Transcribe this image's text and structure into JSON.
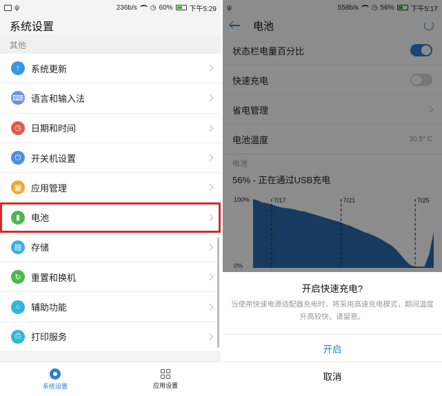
{
  "left": {
    "statusbar": {
      "net_speed": "236b/s",
      "battery_pct": "60%",
      "battery_level": 0.6,
      "time": "下午5:29"
    },
    "title": "系统设置",
    "section_label": "其他",
    "items": [
      {
        "label": "系统更新",
        "icon": "system-update-icon",
        "color": "#3a97e0",
        "glyph": "↑"
      },
      {
        "label": "语言和输入法",
        "icon": "keyboard-icon",
        "color": "#6b8fe0",
        "glyph": "⌨"
      },
      {
        "label": "日期和时间",
        "icon": "clock-icon",
        "color": "#e05a4a",
        "glyph": "◷"
      },
      {
        "label": "开关机设置",
        "icon": "power-icon",
        "color": "#4a8fe0",
        "glyph": "⏻"
      },
      {
        "label": "应用管理",
        "icon": "apps-icon",
        "color": "#f0a830",
        "glyph": "▦"
      },
      {
        "label": "电池",
        "icon": "battery-icon",
        "color": "#4cb84c",
        "glyph": "▮"
      },
      {
        "label": "存储",
        "icon": "storage-icon",
        "color": "#3ab0e0",
        "glyph": "▤"
      },
      {
        "label": "重置和换机",
        "icon": "reset-icon",
        "color": "#4cb84c",
        "glyph": "↻"
      },
      {
        "label": "辅助功能",
        "icon": "accessibility-icon",
        "color": "#2fb6d8",
        "glyph": "○"
      },
      {
        "label": "打印服务",
        "icon": "print-icon",
        "color": "#2fb6d8",
        "glyph": "⎙"
      }
    ],
    "nav": {
      "settings": "系统设置",
      "apps": "应用设置"
    }
  },
  "right": {
    "statusbar": {
      "net_speed": "558b/s",
      "battery_pct": "56%",
      "battery_level": 0.56,
      "time": "下午5:17"
    },
    "title": "电池",
    "rows": {
      "percentage": "状态栏电量百分比",
      "fast_charge": "快速充电",
      "power_saving": "省电管理",
      "temperature": "电池温度",
      "temperature_value": "30.5° C"
    },
    "section_label": "电池",
    "battery_status": "56% - 正在通过USB充电",
    "dialog": {
      "title": "开启快速充电?",
      "body": "当使用快速电源适配器充电时，将采用高速充电模式，期间温度升高较快，请留意。",
      "confirm": "开启",
      "cancel": "取消"
    }
  },
  "chart_data": {
    "type": "area",
    "ylim": [
      0,
      100
    ],
    "ytick_labels": [
      "100%",
      "0%"
    ],
    "date_markers": [
      "7/17",
      "7/21",
      "7/25"
    ],
    "x": [
      0,
      1,
      2,
      3,
      4,
      5,
      6,
      7,
      8,
      9,
      10,
      11,
      12,
      13,
      14,
      15,
      16,
      17,
      18,
      19,
      20,
      21,
      22,
      23,
      24,
      25,
      26,
      27,
      28,
      29,
      30,
      31,
      32,
      33,
      34,
      35,
      36,
      37,
      38,
      39
    ],
    "values": [
      100,
      98,
      95,
      94,
      92,
      90,
      88,
      87,
      86,
      85,
      83,
      82,
      80,
      78,
      76,
      74,
      72,
      70,
      68,
      66,
      63,
      61,
      58,
      55,
      52,
      50,
      47,
      44,
      40,
      36,
      32,
      26,
      18,
      10,
      4,
      2,
      2,
      2,
      20,
      52
    ],
    "marker_x": [
      4,
      19,
      35
    ],
    "color": "#2b6cb0"
  }
}
